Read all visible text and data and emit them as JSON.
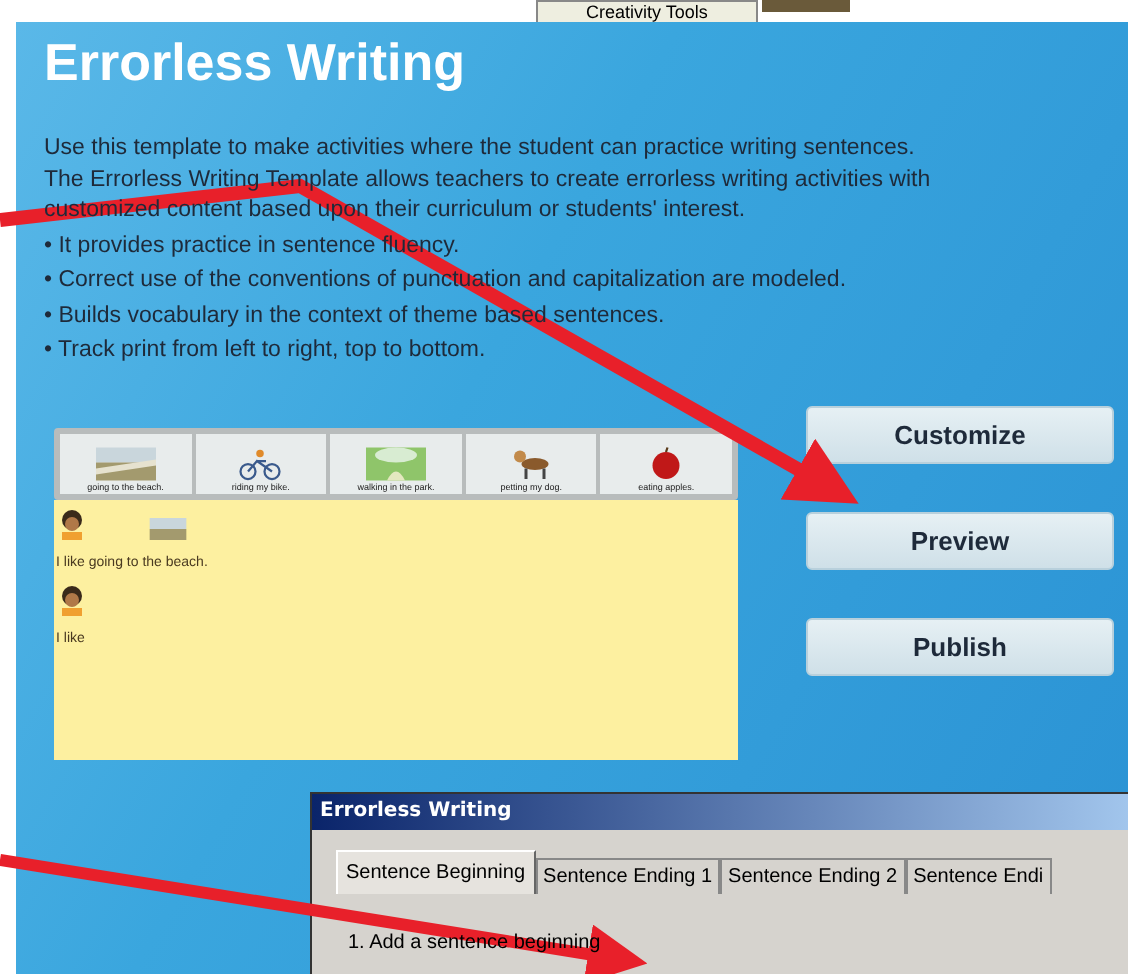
{
  "top_strip": {
    "tab": "Creativity Tools"
  },
  "page": {
    "title": "Errorless Writing",
    "intro": "Use this template to make activities where the student can practice writing sentences. The Errorless Writing Template allows teachers to create errorless writing activities with customized content based upon their curriculum or students' interest.",
    "bullets": [
      "• It provides practice in sentence fluency.",
      "• Correct use of the conventions of punctuation and capitalization are modeled.",
      "• Builds vocabulary in the context of theme based sentences.",
      "• Track print from left to right, top to bottom."
    ]
  },
  "picture_bar": [
    {
      "kind": "beach",
      "caption": "going to the beach."
    },
    {
      "kind": "bike",
      "caption": "riding my bike."
    },
    {
      "kind": "park",
      "caption": "walking in the park."
    },
    {
      "kind": "dog",
      "caption": "petting my dog."
    },
    {
      "kind": "apple",
      "caption": "eating apples."
    }
  ],
  "sentences": [
    {
      "text": "I like going to the beach.",
      "has_picture": true
    },
    {
      "text": "I like",
      "has_picture": false
    }
  ],
  "buttons": [
    "Customize",
    "Preview",
    "Publish"
  ],
  "dialog": {
    "title": "Errorless Writing",
    "tabs": [
      {
        "label": "Sentence Beginning",
        "selected": true
      },
      {
        "label": "Sentence Ending 1",
        "selected": false
      },
      {
        "label": "Sentence Ending 2",
        "selected": false
      },
      {
        "label": "Sentence Endi",
        "selected": false
      }
    ],
    "instruction": "1. Add a sentence beginning"
  }
}
